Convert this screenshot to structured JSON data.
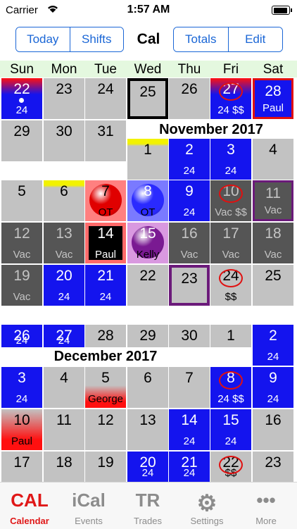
{
  "status_bar": {
    "carrier": "Carrier",
    "time": "1:57 AM"
  },
  "toolbar": {
    "left": [
      "Today",
      "Shifts"
    ],
    "title": "Cal",
    "right": [
      "Totals",
      "Edit"
    ],
    "accent": "#1a66d6"
  },
  "weekdays": [
    "Sun",
    "Mon",
    "Tue",
    "Wed",
    "Thu",
    "Fri",
    "Sat"
  ],
  "months": [
    "November 2017",
    "December 2017"
  ],
  "days": [
    {
      "n": "22",
      "s": "24",
      "style": "red-blue-top",
      "dot": true
    },
    {
      "n": "23",
      "s": "",
      "style": "gray"
    },
    {
      "n": "24",
      "s": "",
      "style": "gray"
    },
    {
      "n": "25",
      "s": "",
      "style": "today"
    },
    {
      "n": "26",
      "s": "",
      "style": "gray"
    },
    {
      "n": "27",
      "s": "24 $$",
      "style": "red-blue-top",
      "ring": true
    },
    {
      "n": "28",
      "s": "Paul",
      "style": "blue-red-border"
    },
    {
      "n": "29",
      "s": "",
      "style": "gray"
    },
    {
      "n": "30",
      "s": "",
      "style": "gray"
    },
    {
      "n": "31",
      "s": "",
      "style": "gray"
    },
    {
      "n": "1",
      "s": "",
      "style": "yellow-top"
    },
    {
      "n": "2",
      "s": "24",
      "style": "blue"
    },
    {
      "n": "3",
      "s": "24",
      "style": "blue"
    },
    {
      "n": "4",
      "s": "",
      "style": "gray"
    },
    {
      "n": "5",
      "s": "",
      "style": "gray"
    },
    {
      "n": "6",
      "s": "",
      "style": "yellow-top"
    },
    {
      "n": "7",
      "s": "OT",
      "style": "red-ball"
    },
    {
      "n": "8",
      "s": "OT",
      "style": "blue-ball"
    },
    {
      "n": "9",
      "s": "24",
      "style": "blue"
    },
    {
      "n": "10",
      "s": "Vac $$",
      "style": "dark",
      "ring": true
    },
    {
      "n": "11",
      "s": "Vac",
      "style": "dark-purple"
    },
    {
      "n": "12",
      "s": "Vac",
      "style": "dark"
    },
    {
      "n": "13",
      "s": "Vac",
      "style": "dark"
    },
    {
      "n": "14",
      "s": "Paul",
      "style": "black-red"
    },
    {
      "n": "15",
      "s": "Kelly",
      "style": "purple-ball"
    },
    {
      "n": "16",
      "s": "Vac",
      "style": "dark"
    },
    {
      "n": "17",
      "s": "Vac",
      "style": "dark"
    },
    {
      "n": "18",
      "s": "Vac",
      "style": "dark"
    },
    {
      "n": "19",
      "s": "Vac",
      "style": "dark"
    },
    {
      "n": "20",
      "s": "24",
      "style": "blue"
    },
    {
      "n": "21",
      "s": "24",
      "style": "blue"
    },
    {
      "n": "22",
      "s": "",
      "style": "gray"
    },
    {
      "n": "23",
      "s": "",
      "style": "purple-frame"
    },
    {
      "n": "24",
      "s": "$$",
      "style": "gray",
      "ring": true
    },
    {
      "n": "25",
      "s": "",
      "style": "gray"
    },
    {
      "n": "26",
      "s": "24",
      "style": "blue"
    },
    {
      "n": "27",
      "s": "24",
      "style": "blue"
    },
    {
      "n": "28",
      "s": "",
      "style": "gray"
    },
    {
      "n": "29",
      "s": "",
      "style": "gray"
    },
    {
      "n": "30",
      "s": "",
      "style": "gray"
    },
    {
      "n": "1",
      "s": "",
      "style": "gray"
    },
    {
      "n": "2",
      "s": "24",
      "style": "blue"
    },
    {
      "n": "3",
      "s": "24",
      "style": "blue"
    },
    {
      "n": "4",
      "s": "",
      "style": "gray"
    },
    {
      "n": "5",
      "s": "George",
      "style": "george"
    },
    {
      "n": "6",
      "s": "",
      "style": "gray"
    },
    {
      "n": "7",
      "s": "",
      "style": "gray"
    },
    {
      "n": "8",
      "s": "24 $$",
      "style": "blue",
      "ring": true
    },
    {
      "n": "9",
      "s": "24",
      "style": "blue"
    },
    {
      "n": "10",
      "s": "Paul",
      "style": "paul-red"
    },
    {
      "n": "11",
      "s": "",
      "style": "gray"
    },
    {
      "n": "12",
      "s": "",
      "style": "gray"
    },
    {
      "n": "13",
      "s": "",
      "style": "gray"
    },
    {
      "n": "14",
      "s": "24",
      "style": "blue"
    },
    {
      "n": "15",
      "s": "24",
      "style": "blue"
    },
    {
      "n": "16",
      "s": "",
      "style": "gray"
    },
    {
      "n": "17",
      "s": "",
      "style": "gray"
    },
    {
      "n": "18",
      "s": "",
      "style": "gray"
    },
    {
      "n": "19",
      "s": "",
      "style": "gray"
    },
    {
      "n": "20",
      "s": "24",
      "style": "blue"
    },
    {
      "n": "21",
      "s": "24",
      "style": "blue"
    },
    {
      "n": "22",
      "s": "$$",
      "style": "gray",
      "ring": true
    },
    {
      "n": "23",
      "s": "",
      "style": "gray"
    }
  ],
  "tabs": [
    {
      "icon": "CAL",
      "label": "Calendar",
      "active": true,
      "icon_name": "calendar-icon"
    },
    {
      "icon": "iCal",
      "label": "Events",
      "active": false,
      "icon_name": "events-icon"
    },
    {
      "icon": "TR",
      "label": "Trades",
      "active": false,
      "icon_name": "trades-icon"
    },
    {
      "icon": "⚙",
      "label": "Settings",
      "active": false,
      "icon_name": "gear-icon"
    },
    {
      "icon": "•••",
      "label": "More",
      "active": false,
      "icon_name": "more-icon"
    }
  ],
  "colors": {
    "blue_shift": "#1414ee",
    "off": "#c2c2c2",
    "vacation": "#555555",
    "red_accent": "#e01818",
    "weekday_header": "#e4f8df"
  }
}
